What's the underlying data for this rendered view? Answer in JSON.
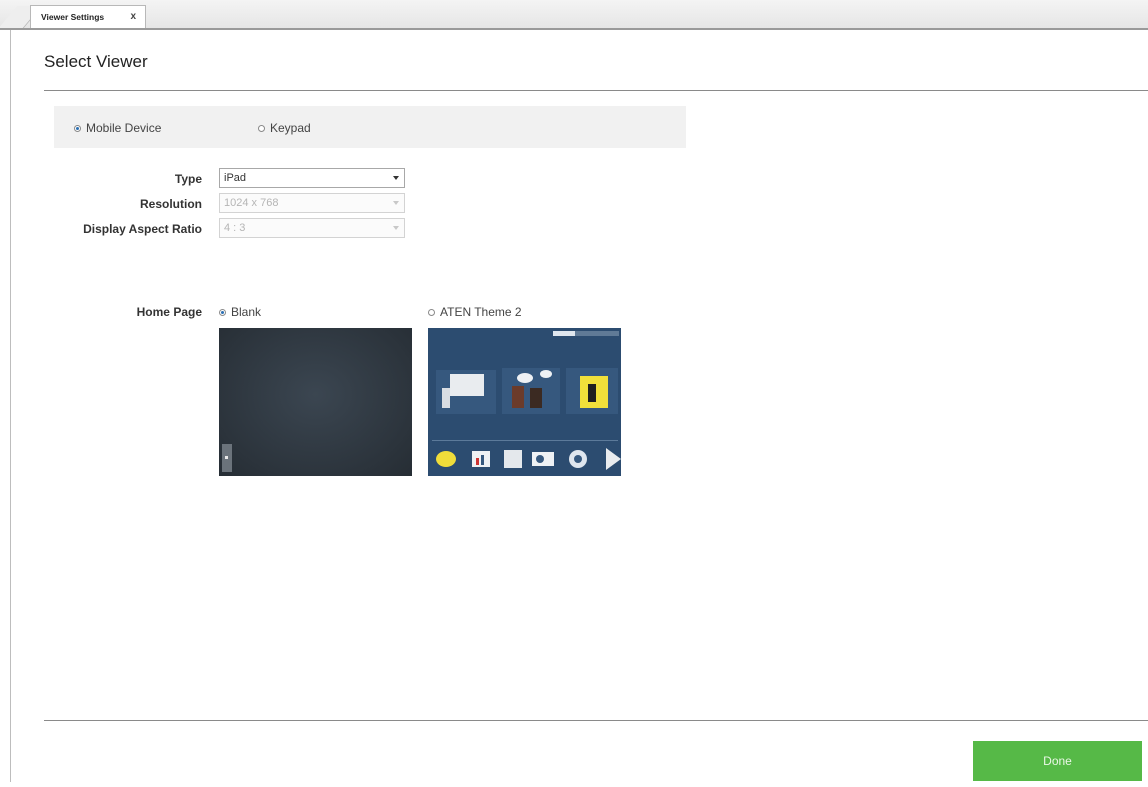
{
  "tab": {
    "label": "Viewer Settings",
    "close": "x"
  },
  "page": {
    "title": "Select Viewer"
  },
  "viewer_mode": {
    "options": [
      {
        "label": "Mobile Device",
        "selected": true
      },
      {
        "label": "Keypad",
        "selected": false
      }
    ]
  },
  "fields": {
    "type": {
      "label": "Type",
      "value": "iPad",
      "enabled": true
    },
    "resolution": {
      "label": "Resolution",
      "value": "1024 x 768",
      "enabled": false
    },
    "aspect_ratio": {
      "label": "Display Aspect Ratio",
      "value": "4 : 3",
      "enabled": false
    }
  },
  "home_page": {
    "label": "Home Page",
    "options": [
      {
        "label": "Blank",
        "selected": true
      },
      {
        "label": "ATEN Theme 2",
        "selected": false
      }
    ]
  },
  "footer": {
    "done_label": "Done"
  },
  "colors": {
    "accent": "#56b947",
    "radio_selected": "#2a6fb3",
    "theme_bg": "#2c4c70"
  }
}
